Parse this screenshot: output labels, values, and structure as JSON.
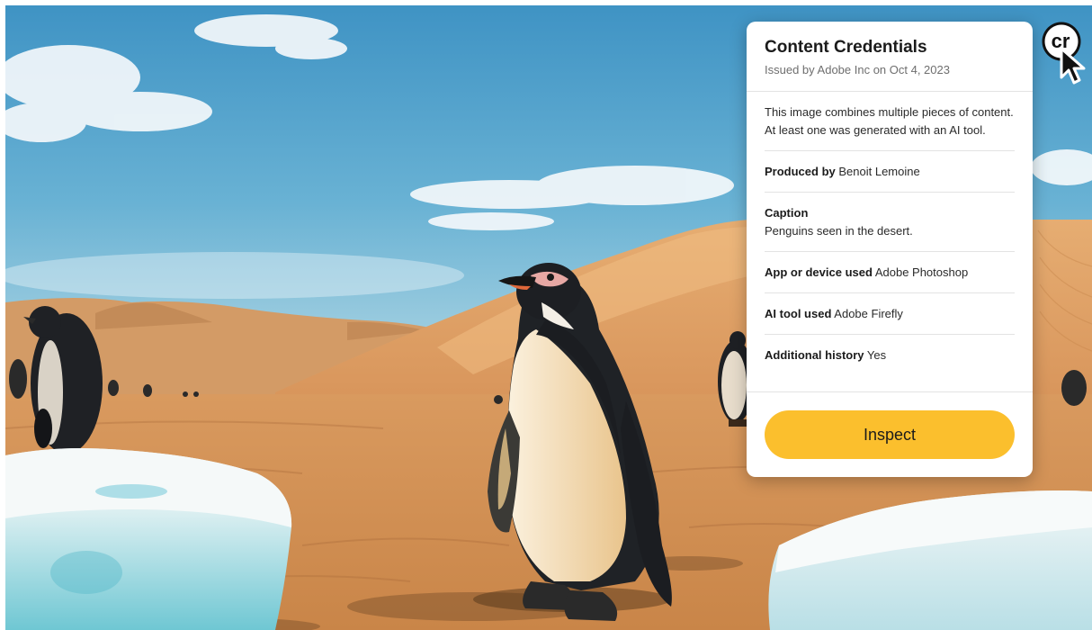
{
  "panel": {
    "title": "Content Credentials",
    "issued": "Issued by Adobe Inc on Oct 4, 2023",
    "summary": "This image combines multiple pieces of content. At least one was generated with an AI tool.",
    "produced_by": {
      "label": "Produced by",
      "value": "Benoit Lemoine"
    },
    "caption": {
      "label": "Caption",
      "value": "Penguins seen in the desert."
    },
    "app_used": {
      "label": "App or device used",
      "value": "Adobe Photoshop"
    },
    "ai_tool": {
      "label": "AI tool used",
      "value": "Adobe Firefly"
    },
    "history": {
      "label": "Additional history",
      "value": "Yes"
    },
    "inspect_label": "Inspect"
  },
  "badge": {
    "text": "cr",
    "icon": "content-credentials-icon"
  },
  "colors": {
    "inspect_button": "#fbbf2d",
    "sky": "#4aa0cc",
    "sand": "#d89a5c"
  }
}
